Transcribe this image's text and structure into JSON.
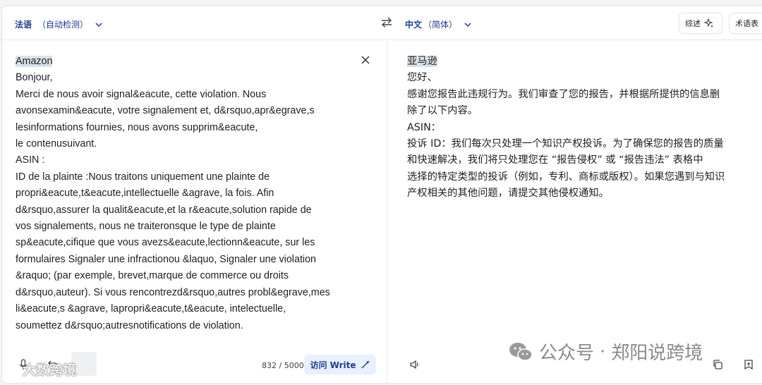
{
  "header": {
    "source_lang": "法语",
    "source_sub": "（自动检测）",
    "target_lang": "中文",
    "target_sub": "（简体）",
    "summary_btn": "综述",
    "glossary_btn": "术语表"
  },
  "source": {
    "lines": [
      "Amazon",
      "Bonjour,",
      "Merci de nous avoir signal&eacute, cette violation. Nous",
      "avonsexamin&eacute, votre signalement et, d&rsquo,apr&egrave,s",
      "lesinformations fournies, nous avons supprim&eacute,",
      "le contenusuivant.",
      "ASIN :",
      "ID de la plainte :Nous traitons uniquement une plainte de",
      "propri&eacute,t&eacute,intellectuelle &agrave, la fois. Afin",
      "d&rsquo,assurer la qualit&eacute,et la r&eacute,solution rapide de",
      "vos signalements, nous ne traiteronsque le type de plainte",
      "sp&eacute,cifique que vous avezs&eacute,lectionn&eacute, sur les",
      "formulaires Signaler une infractionou &laquo, Signaler une violation",
      "&raquo; (par exemple, brevet,marque de commerce ou droits",
      "d&rsquo,auteur). Si vous rencontrezd&rsquo,autres probl&egrave,mes",
      "li&eacute,s &agrave, lapropri&eacute,t&eacute, intelectuelle,",
      "soumettez d&rsquo;autresnotifications de violation."
    ],
    "char_count": "832 / 5000",
    "write_btn": "访问 Write"
  },
  "target": {
    "lines": [
      "亚马逊",
      "您好、",
      "感谢您报告此违规行为。我们审查了您的报告，并根据所提供的信息删",
      "除了以下内容。",
      "ASIN：",
      "投诉 ID：我们每次只处理一个知识产权投诉。为了确保您的报告的质量",
      "和快速解决，我们将只处理您在 “报告侵权” 或 “报告违法” 表格中",
      "选择的特定类型的投诉（例如，专利、商标或版权）。如果您遇到与知识",
      "产权相关的其他问题，请提交其他侵权通知。"
    ]
  },
  "watermarks": {
    "left": "大数跨境",
    "right_a": "公众号",
    "right_sep": "·",
    "right_b": "郑阳说跨境"
  },
  "colors": {
    "accent": "#1a3d8f",
    "highlight": "#d9e2ea",
    "write_bg": "#e8f0fe"
  }
}
